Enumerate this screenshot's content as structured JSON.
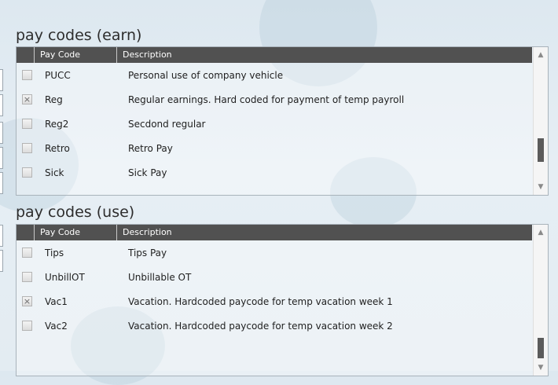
{
  "earn_section": {
    "title": "pay codes (earn)",
    "columns": {
      "code": "Pay Code",
      "description": "Description"
    },
    "rows": [
      {
        "code": "PUCC",
        "description": "Personal use of company vehicle",
        "checked": false
      },
      {
        "code": "Reg",
        "description": "Regular earnings.  Hard coded for payment of temp payroll",
        "checked": true
      },
      {
        "code": "Reg2",
        "description": "Secdond regular",
        "checked": false
      },
      {
        "code": "Retro",
        "description": "Retro Pay",
        "checked": false
      },
      {
        "code": "Sick",
        "description": "Sick Pay",
        "checked": false
      }
    ]
  },
  "use_section": {
    "title": "pay codes (use)",
    "columns": {
      "code": "Pay Code",
      "description": "Description"
    },
    "rows": [
      {
        "code": "Tips",
        "description": "Tips Pay",
        "checked": false
      },
      {
        "code": "UnbillOT",
        "description": "Unbillable OT",
        "checked": false
      },
      {
        "code": "Vac1",
        "description": "Vacation. Hardcoded paycode for temp vacation week 1",
        "checked": true
      },
      {
        "code": "Vac2",
        "description": "Vacation. Hardcoded paycode for temp vacation week 2",
        "checked": false
      }
    ]
  },
  "icons": {
    "checked_mark": "×",
    "scroll_up": "▲",
    "scroll_down": "▼"
  },
  "colors": {
    "header_bg": "#515151",
    "scroll_thumb": "#5b5b5b",
    "background": "#e3ecf2"
  }
}
